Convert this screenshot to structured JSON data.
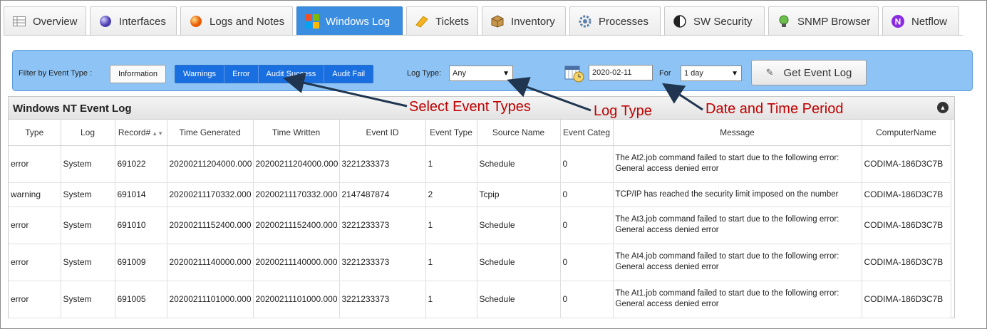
{
  "tabs": [
    {
      "label": "Overview",
      "icon": "table-icon",
      "active": false
    },
    {
      "label": "Interfaces",
      "icon": "sphere-icon",
      "active": false
    },
    {
      "label": "Logs and Notes",
      "icon": "orange-ball-icon",
      "active": false
    },
    {
      "label": "Windows Log",
      "icon": "windows-logo-icon",
      "active": true
    },
    {
      "label": "Tickets",
      "icon": "ticket-icon",
      "active": false
    },
    {
      "label": "Inventory",
      "icon": "box-icon",
      "active": false
    },
    {
      "label": "Processes",
      "icon": "gear-icon",
      "active": false
    },
    {
      "label": "SW Security",
      "icon": "half-circle-icon",
      "active": false
    },
    {
      "label": "SNMP Browser",
      "icon": "snmp-icon",
      "active": false
    },
    {
      "label": "Netflow",
      "icon": "netflow-n-icon",
      "active": false
    }
  ],
  "filter": {
    "label": "Filter by Event Type :",
    "event_types": [
      {
        "label": "Information",
        "selected": false
      },
      {
        "label": "Warnings",
        "selected": true
      },
      {
        "label": "Error",
        "selected": true
      },
      {
        "label": "Audit Success",
        "selected": true
      },
      {
        "label": "Audit Fail",
        "selected": true
      }
    ],
    "log_type_label": "Log Type:",
    "log_type_value": "Any",
    "date_value": "2020-02-11",
    "for_label": "For",
    "period_value": "1 day",
    "get_button": "Get Event Log"
  },
  "annotations": {
    "select_event_types": "Select Event Types",
    "log_type": "Log Type",
    "date_time_period": "Date and Time Period"
  },
  "panel": {
    "title": "Windows NT Event Log",
    "columns": [
      "Type",
      "Log",
      "Record#",
      "Time Generated",
      "Time Written",
      "Event ID",
      "Event Type",
      "Source Name",
      "Event Categ",
      "Message",
      "ComputerName"
    ],
    "rows": [
      {
        "type": "error",
        "log": "System",
        "record": "691022",
        "time_generated": "20200211204000.000",
        "time_written": "20200211204000.000",
        "event_id": "3221233373",
        "event_type": "1",
        "source": "Schedule",
        "category": "0",
        "message": "The At2.job command failed to start due to the following error: General access denied error",
        "computer": "CODIMA-186D3C7B"
      },
      {
        "type": "warning",
        "log": "System",
        "record": "691014",
        "time_generated": "20200211170332.000",
        "time_written": "20200211170332.000",
        "event_id": "2147487874",
        "event_type": "2",
        "source": "Tcpip",
        "category": "0",
        "message": "TCP/IP has reached the security limit imposed on the number",
        "computer": "CODIMA-186D3C7B"
      },
      {
        "type": "error",
        "log": "System",
        "record": "691010",
        "time_generated": "20200211152400.000",
        "time_written": "20200211152400.000",
        "event_id": "3221233373",
        "event_type": "1",
        "source": "Schedule",
        "category": "0",
        "message": "The At3.job command failed to start due to the following error: General access denied error",
        "computer": "CODIMA-186D3C7B"
      },
      {
        "type": "error",
        "log": "System",
        "record": "691009",
        "time_generated": "20200211140000.000",
        "time_written": "20200211140000.000",
        "event_id": "3221233373",
        "event_type": "1",
        "source": "Schedule",
        "category": "0",
        "message": "The At4.job command failed to start due to the following error: General access denied error",
        "computer": "CODIMA-186D3C7B"
      },
      {
        "type": "error",
        "log": "System",
        "record": "691005",
        "time_generated": "20200211101000.000",
        "time_written": "20200211101000.000",
        "event_id": "3221233373",
        "event_type": "1",
        "source": "Schedule",
        "category": "0",
        "message": "The At1.job command failed to start due to the following error: General access denied error",
        "computer": "CODIMA-186D3C7B"
      }
    ]
  },
  "colors": {
    "accent": "#3b8de0",
    "filter_bg": "#8ec4f5",
    "annotation": "#c00000"
  }
}
